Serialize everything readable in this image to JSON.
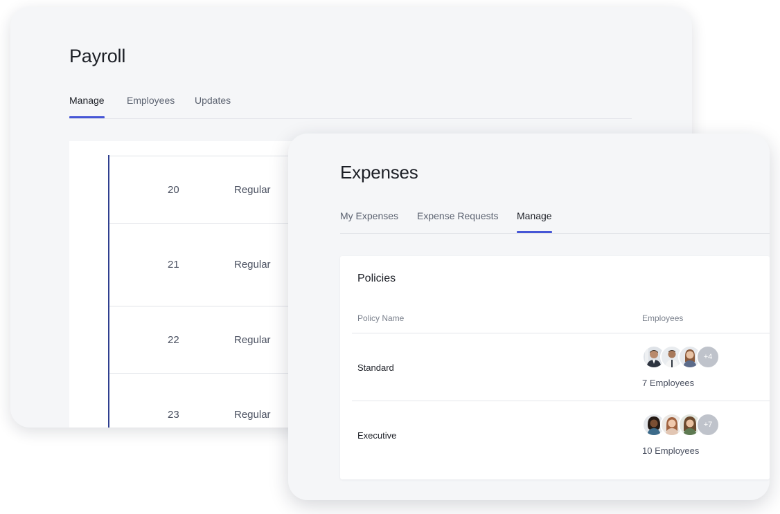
{
  "payroll": {
    "title": "Payroll",
    "tabs": [
      {
        "label": "Manage",
        "active": true
      },
      {
        "label": "Employees",
        "active": false
      },
      {
        "label": "Updates",
        "active": false
      }
    ],
    "rows": [
      {
        "number": "20",
        "type": "Regular"
      },
      {
        "number": "21",
        "type": "Regular"
      },
      {
        "number": "22",
        "type": "Regular"
      },
      {
        "number": "23",
        "type": "Regular"
      }
    ]
  },
  "expenses": {
    "title": "Expenses",
    "tabs": [
      {
        "label": "My Expenses",
        "active": false
      },
      {
        "label": "Expense Requests",
        "active": false
      },
      {
        "label": "Manage",
        "active": true
      }
    ],
    "policies": {
      "title": "Policies",
      "columns": {
        "name": "Policy Name",
        "employees": "Employees"
      },
      "rows": [
        {
          "name": "Standard",
          "extra_badge": "+4",
          "employee_count": "7 Employees"
        },
        {
          "name": "Executive",
          "extra_badge": "+7",
          "employee_count": "10 Employees"
        }
      ]
    }
  },
  "colors": {
    "accent": "#4656d6",
    "timeline": "#2f3f8f",
    "card_bg": "#f5f6f8"
  }
}
